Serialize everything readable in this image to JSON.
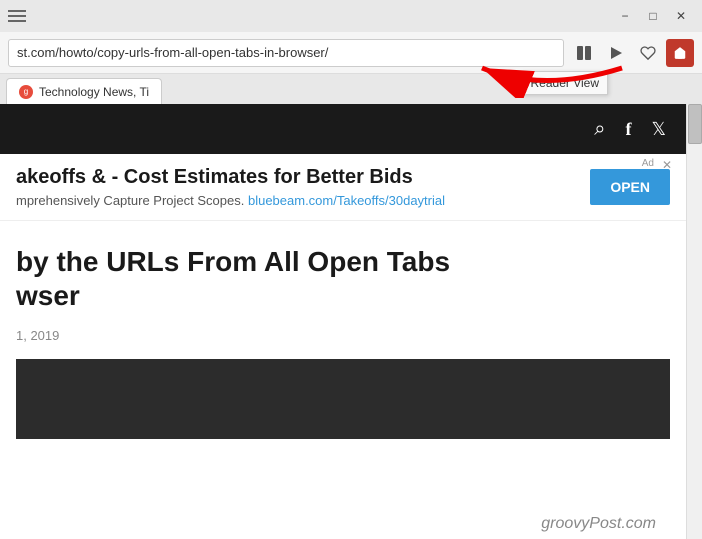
{
  "titlebar": {
    "minimize_label": "−",
    "restore_label": "□",
    "close_label": "✕"
  },
  "addressbar": {
    "url": "st.com/howto/copy-urls-from-all-open-tabs-in-browser/",
    "reader_view_tooltip": "Reader View"
  },
  "tabbar": {
    "tab_text": "Technology News, Ti",
    "favicon_letter": "g"
  },
  "site_header": {
    "search_icon": "🔍",
    "facebook_icon": "f",
    "twitter_icon": "🐦"
  },
  "ad": {
    "title": "akeoffs & - Cost Estimates for Better Bids",
    "description": "mprehensively Capture Project Scopes.",
    "link_text": "bluebeam.com/Takeoffs/30daytrial",
    "open_button": "OPEN",
    "ad_label": "Ad"
  },
  "article": {
    "title_line1": "by the URLs From All Open Tabs",
    "title_line2": "wser",
    "date": "1, 2019"
  },
  "branding": {
    "text": "groovyPost.com"
  }
}
